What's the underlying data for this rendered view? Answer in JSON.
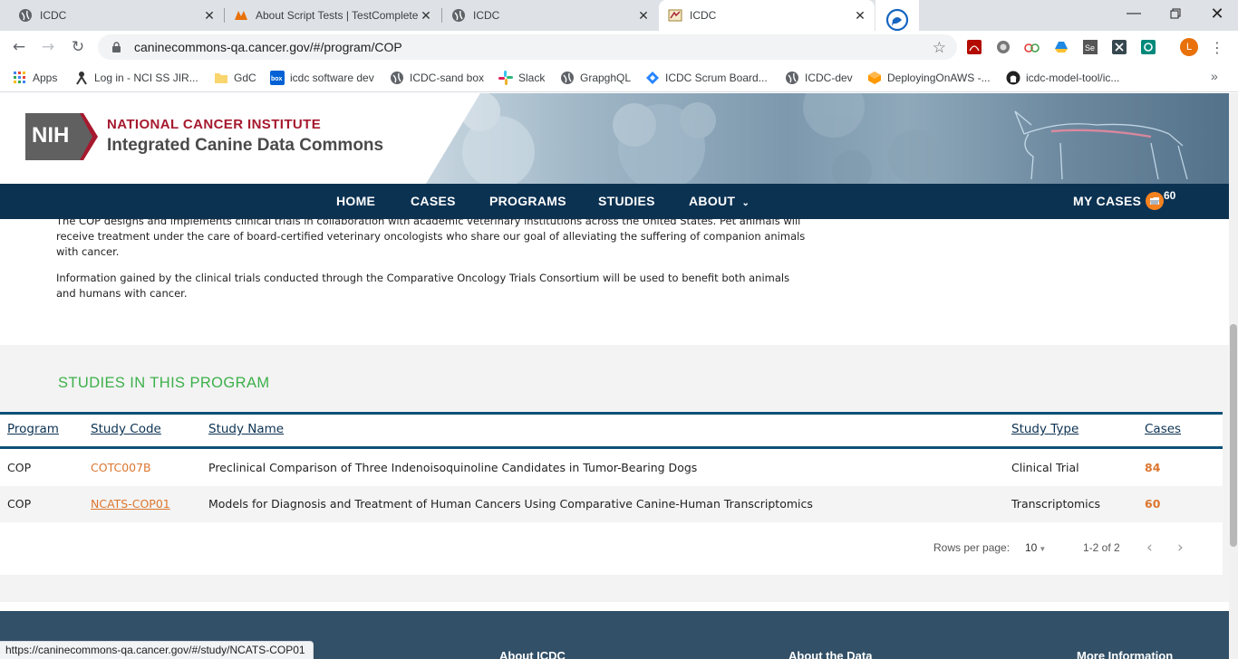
{
  "browser": {
    "tabs": [
      {
        "label": "ICDC",
        "icon": "globe-icon"
      },
      {
        "label": "About Script Tests | TestComplete",
        "icon": "testcomplete-icon"
      },
      {
        "label": "ICDC",
        "icon": "globe-icon"
      },
      {
        "label": "ICDC",
        "icon": "icdc-favicon"
      }
    ],
    "close_glyph": "✕",
    "url": "caninecommons-qa.cancer.gov/#/program/COP",
    "avatar_letter": "L",
    "bookmarks": [
      {
        "label": "Apps",
        "icon": "apps-grid-icon"
      },
      {
        "label": "Log in - NCI SS JIR...",
        "icon": "jira-icon"
      },
      {
        "label": "GdC",
        "icon": "folder-icon"
      },
      {
        "label": "icdc software dev",
        "icon": "box-icon"
      },
      {
        "label": "ICDC-sand box",
        "icon": "globe-icon"
      },
      {
        "label": "Slack",
        "icon": "slack-icon"
      },
      {
        "label": "GrapghQL",
        "icon": "globe-icon"
      },
      {
        "label": "ICDC Scrum Board...",
        "icon": "jira-diamond-icon"
      },
      {
        "label": "ICDC-dev",
        "icon": "globe-icon"
      },
      {
        "label": "DeployingOnAWS -...",
        "icon": "aws-icon"
      },
      {
        "label": "icdc-model-tool/ic...",
        "icon": "github-icon"
      }
    ],
    "status_url": "https://caninecommons-qa.cancer.gov/#/study/NCATS-COP01"
  },
  "site": {
    "logo_line1": "NATIONAL CANCER INSTITUTE",
    "logo_line2": "Integrated Canine Data Commons",
    "nih_text": "NIH",
    "nav": [
      "HOME",
      "CASES",
      "PROGRAMS",
      "STUDIES",
      "ABOUT"
    ],
    "my_cases_label": "MY CASES",
    "my_cases_count": "60"
  },
  "program": {
    "description_p1": "The COP designs and implements clinical trials in collaboration with academic veterinary institutions across the United States. Pet animals will receive treatment under the care of board-certified veterinary oncologists who share our goal of alleviating the suffering of companion animals with cancer.",
    "description_p2": "Information gained by the clinical trials conducted through the Comparative Oncology Trials Consortium will be used to benefit both animals and humans with cancer."
  },
  "studies": {
    "title": "STUDIES IN THIS PROGRAM",
    "columns": [
      "Program",
      "Study Code",
      "Study Name",
      "Study Type",
      "Cases"
    ],
    "rows": [
      {
        "program": "COP",
        "code": "COTC007B",
        "name": "Preclinical Comparison of Three Indenoisoquinoline Candidates in Tumor-Bearing Dogs",
        "type": "Clinical Trial",
        "cases": "84"
      },
      {
        "program": "COP",
        "code": "NCATS-COP01",
        "name": "Models for Diagnosis and Treatment of Human Cancers Using Comparative Canine-Human Transcriptomics",
        "type": "Transcriptomics",
        "cases": "60"
      }
    ],
    "rows_per_page_label": "Rows per page:",
    "rows_per_page_value": "10",
    "range_label": "1-2 of 2"
  },
  "footer": {
    "headings": [
      "About ICDC",
      "About the Data",
      "More Information"
    ]
  },
  "colors": {
    "nav_bg": "#0c3252",
    "accent_green": "#3cb04a",
    "link_orange": "#dc762f",
    "nih_red": "#a6192e"
  }
}
